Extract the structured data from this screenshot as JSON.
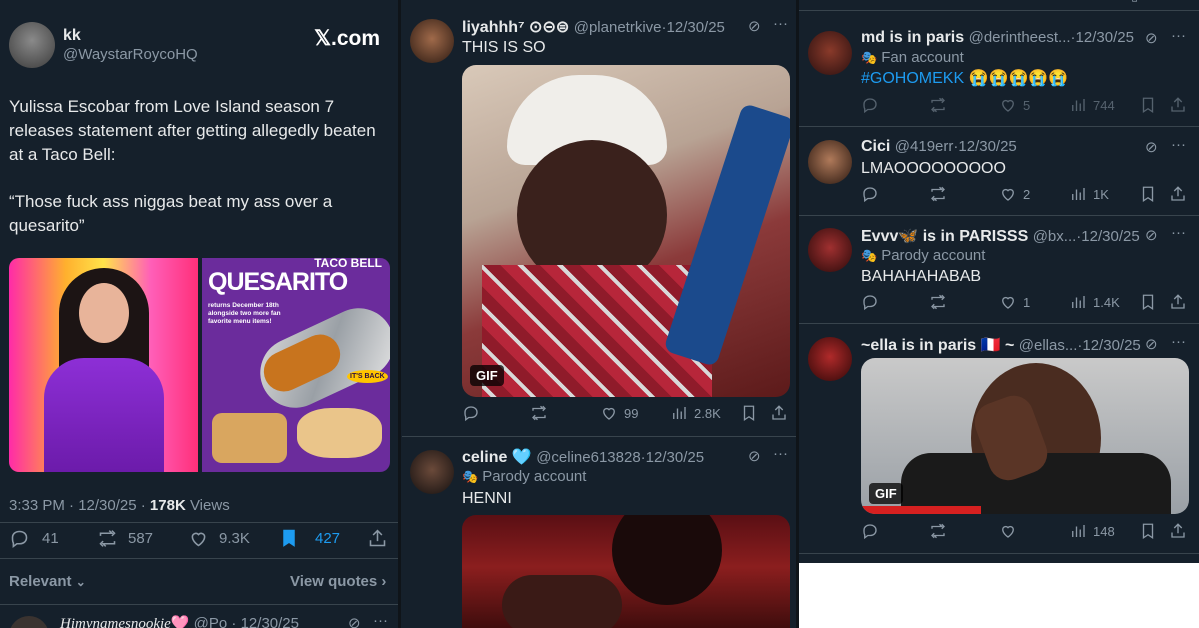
{
  "main": {
    "author_name": "kk",
    "author_handle": "@WaystarRoycoHQ",
    "source": "𝕏.com",
    "text_lines": [
      "Yulissa Escobar from Love Island season 7",
      "releases statement after getting allegedly beaten",
      "at a Taco Bell:"
    ],
    "quote_lines": [
      "“Those fuck ass niggas beat my ass over a",
      "quesarito”"
    ],
    "image2_brand": "TACO BELL",
    "image2_title": "QUESARITO",
    "image2_sub": "returns December 18th alongside two more fan favorite menu items!",
    "image2_badge": "IT'S BACK",
    "timestamp": "3:33 PM · 12/30/25 · ",
    "views_count": "178K",
    "views_label": " Views",
    "replies": "41",
    "reposts": "587",
    "likes": "9.3K",
    "bookmarks": "427",
    "relevant_label": "Relevant",
    "view_quotes_label": "View quotes",
    "next_reply_name": "Himynamesnookie",
    "next_reply_handle": "@Po",
    "next_reply_date": "12/30/25"
  },
  "col2": {
    "r1": {
      "name": "liyahhh⁷ ⊙⊝⊜",
      "handle": "@planetrkive",
      "date": "12/30/25",
      "text": "THIS IS SO",
      "gif": "GIF",
      "likes": "99",
      "views": "2.8K"
    },
    "r2": {
      "name": "celine 🩵",
      "handle": "@celine613828",
      "date": "12/30/25",
      "label": "Parody account",
      "text": "HENNI"
    }
  },
  "col3": {
    "r1": {
      "name": "md is in paris",
      "handle": "@derintheest...",
      "date": "12/30/25",
      "label": "Fan account",
      "hashtag": "#GOHOMEKK",
      "emojis": "😭😭😭😭😭",
      "likes": "5",
      "views": "744"
    },
    "r2": {
      "name": "Cici",
      "handle": "@419err",
      "date": "12/30/25",
      "text": "LMAOOOOOOOOO",
      "likes": "2",
      "views": "1K"
    },
    "r3": {
      "name": "Evvv🦋 is in PARISSS",
      "handle": "@bx...",
      "date": "12/30/25",
      "label": "Parody account",
      "text": "BAHAHAHABAB",
      "likes": "1",
      "views": "1.4K"
    },
    "r4": {
      "name": "~ella is in paris 🇫🇷 ~",
      "handle": "@ellas...",
      "date": "12/30/25",
      "gif": "GIF",
      "views": "148"
    }
  },
  "colors": {
    "bg": "#15202b",
    "accent": "#1d9bf0",
    "muted": "#8b98a5",
    "border": "#38444d"
  }
}
